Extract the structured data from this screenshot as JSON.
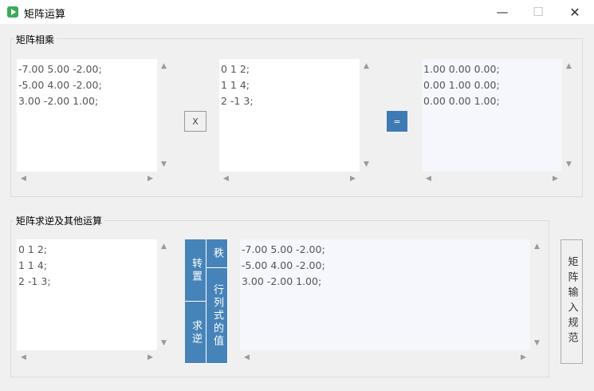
{
  "window": {
    "title": "矩阵运算",
    "minimize": "—",
    "maximize": "☐",
    "close": "✕",
    "icon": "play-icon",
    "icon_color": "#3cab58"
  },
  "multiply_group": {
    "title": "矩阵相乘",
    "matrix_a": "-7.00 5.00 -2.00;\n-5.00 4.00 -2.00;\n3.00 -2.00 1.00;",
    "multiply_label": "X",
    "matrix_b": "0 1 2;\n1 1 4;\n2 -1 3;",
    "equals_label": "=",
    "result": "1.00 0.00 0.00;\n0.00 1.00 0.00;\n0.00 0.00 1.00;"
  },
  "other_group": {
    "title": "矩阵求逆及其他运算",
    "input": "0 1 2;\n1 1 4;\n2 -1 3;",
    "transpose_label": "转置",
    "inverse_label": "求逆",
    "rank_label": "秩",
    "determinant_label": "行列式的值",
    "result": "-7.00 5.00 -2.00;\n-5.00 4.00 -2.00;\n3.00 -2.00 1.00;"
  },
  "input_spec_label": "矩阵输入规范",
  "colors": {
    "accent_blue": "#4683b9",
    "equals_blue": "#3e7ab4",
    "readonly_bg": "#f5f7fc"
  }
}
